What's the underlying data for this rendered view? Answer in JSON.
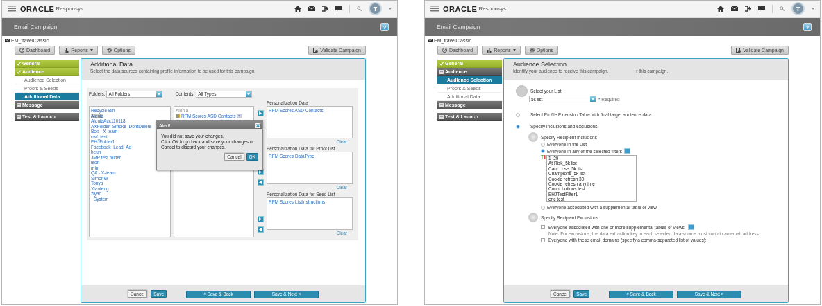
{
  "screens": [
    {
      "kind": "additional_data",
      "header": {
        "logo": "ORACLE",
        "product": "Responsys",
        "avatar": "T"
      },
      "title": "Email Campaign",
      "help": "?",
      "breadcrumb": "EM_travelClassic",
      "toolbar": [
        {
          "label": "Dashboard",
          "kind": "plain"
        },
        {
          "label": "Reports",
          "kind": "menu"
        },
        {
          "label": "Options",
          "kind": "plain"
        }
      ],
      "validate": "Validate Campaign",
      "nav": [
        {
          "label": "General",
          "kind": "section",
          "checked": true
        },
        {
          "label": "Audience",
          "kind": "section",
          "checked": true
        },
        {
          "label": "Audience Selection",
          "kind": "step",
          "selected": false
        },
        {
          "label": "Proofs & Seeds",
          "kind": "step",
          "selected": false
        },
        {
          "label": "Additional Data",
          "kind": "step",
          "selected": true
        },
        {
          "label": "Message",
          "kind": "section",
          "checked": false
        },
        {
          "label": "Test & Launch",
          "kind": "section",
          "checked": false
        }
      ],
      "panel": {
        "title": "Additional Data",
        "subtitle": [
          "Select the data sources containing profile information to be used for this campaign."
        ]
      },
      "folders": {
        "label": "Folders:",
        "value": "All Folders"
      },
      "contents": {
        "label": "Contents:",
        "value": "All Types"
      },
      "folder_list": [
        {
          "label": "Recycle Bin",
          "selected": false
        },
        {
          "label": "Alonia",
          "selected": true
        },
        {
          "label": "AloniaAcc110118",
          "selected": false
        },
        {
          "label": "AXFolder_Smoke_DontDelete",
          "selected": false
        },
        {
          "label": "Bob - X-team",
          "selected": false
        },
        {
          "label": "cwf_test",
          "selected": false
        },
        {
          "label": "EHJFolder1",
          "selected": false
        },
        {
          "label": "Facebook_Lead_Ad",
          "selected": false
        },
        {
          "label": "heun",
          "selected": false
        },
        {
          "label": "JMP test folder",
          "selected": false
        },
        {
          "label": "leon",
          "selected": false
        },
        {
          "label": "min",
          "selected": false
        },
        {
          "label": "QA - X-team",
          "selected": false
        },
        {
          "label": "SimonW",
          "selected": false
        },
        {
          "label": "Tonya",
          "selected": false
        },
        {
          "label": "Xiaofeng",
          "selected": false
        },
        {
          "label": "ziyao",
          "selected": false
        },
        {
          "label": "~System",
          "selected": false
        }
      ],
      "contents_list": {
        "folder": "Alonia",
        "items": [
          "RFM Scores ASD Contacts"
        ]
      },
      "personalization": [
        {
          "title": "Personalization Data",
          "items": [
            "RFM Scores ASD Contacts"
          ],
          "clear": "Clear"
        },
        {
          "title": "Personalization Data for Proof List",
          "items": [
            "RFM Scores DataType"
          ],
          "clear": "Clear"
        },
        {
          "title": "Personalization Data for Seed List",
          "items": [
            "RFM Scores ListInstructions"
          ],
          "clear": "Clear"
        }
      ],
      "alert": {
        "title": "Alert!",
        "message": "You did not save your changes.\nClick OK to go back and save your changes or\nCancel to discard your changes.",
        "buttons": [
          {
            "label": "Cancel",
            "kind": "secondary"
          },
          {
            "label": "OK",
            "kind": "primary"
          }
        ]
      },
      "footer": [
        {
          "label": "Cancel",
          "kind": "secondary"
        },
        {
          "label": "Save",
          "kind": "primary"
        },
        {
          "label": "« Save & Back",
          "kind": "nav"
        },
        {
          "label": "Save & Next »",
          "kind": "nav"
        }
      ]
    },
    {
      "kind": "audience_selection",
      "header": {
        "logo": "ORACLE",
        "product": "Responsys",
        "avatar": "T"
      },
      "title": "Email Campaign",
      "help": "?",
      "breadcrumb": "EM_travelClassic",
      "toolbar": [
        {
          "label": "Dashboard",
          "kind": "plain"
        },
        {
          "label": "Reports",
          "kind": "menu"
        },
        {
          "label": "Options",
          "kind": "plain"
        }
      ],
      "validate": "Validate Campaign",
      "nav": [
        {
          "label": "General",
          "kind": "section",
          "checked": true
        },
        {
          "label": "Audience",
          "kind": "section",
          "checked": false
        },
        {
          "label": "Audience Selection",
          "kind": "step",
          "selected": true
        },
        {
          "label": "Proofs & Seeds",
          "kind": "step",
          "selected": false
        },
        {
          "label": "Additional Data",
          "kind": "step",
          "selected": false
        },
        {
          "label": "Message",
          "kind": "section",
          "checked": false
        },
        {
          "label": "Test & Launch",
          "kind": "section",
          "checked": false
        }
      ],
      "panel": {
        "title": "Audience Selection",
        "subtitle": [
          "Identify your audience to receive this campaign.",
          "r this campaign."
        ]
      },
      "list_step": {
        "label": "Select your List",
        "value": "5k list",
        "required": "* Required"
      },
      "audience_options": [
        {
          "label": "Select Profile Extension Table with final target audience data",
          "selected": false
        },
        {
          "label": "Specify inclusions and exclusions",
          "selected": true
        }
      ],
      "inclusions": {
        "title": "Specify Recipient Inclusions",
        "options": [
          {
            "label": "Everyone in the List",
            "selected": false,
            "info": false
          },
          {
            "label": "Everyone in any of the selected filters",
            "selected": true,
            "info": true,
            "filters": [
              "1_29",
              "At Risk_5k list",
              "Cant Lose_5k list",
              "Champions_5k list",
              "Cookie refresh 30",
              "Cookie refresh anytime",
              "Count buttons test",
              "EHJTestFilter1",
              "enc test"
            ]
          },
          {
            "label": "Everyone associated with a supplemental table or view",
            "selected": false,
            "info": false
          }
        ]
      },
      "exclusions": {
        "title": "Specify Recipient Exclusions",
        "options": [
          {
            "label": "Everyone associated with one or more supplemental tables or views",
            "checked": false,
            "info": true,
            "note": "Note: For exclusions, the data extraction key in each selected data source must contain an email address."
          },
          {
            "label": "Everyone with these email domains (specify a comma-separated list of values):",
            "checked": false,
            "info": false
          }
        ]
      },
      "footer": [
        {
          "label": "Cancel",
          "kind": "secondary"
        },
        {
          "label": "Save",
          "kind": "primary"
        },
        {
          "label": "« Save & Back",
          "kind": "nav"
        },
        {
          "label": "Save & Next »",
          "kind": "nav"
        }
      ]
    }
  ]
}
